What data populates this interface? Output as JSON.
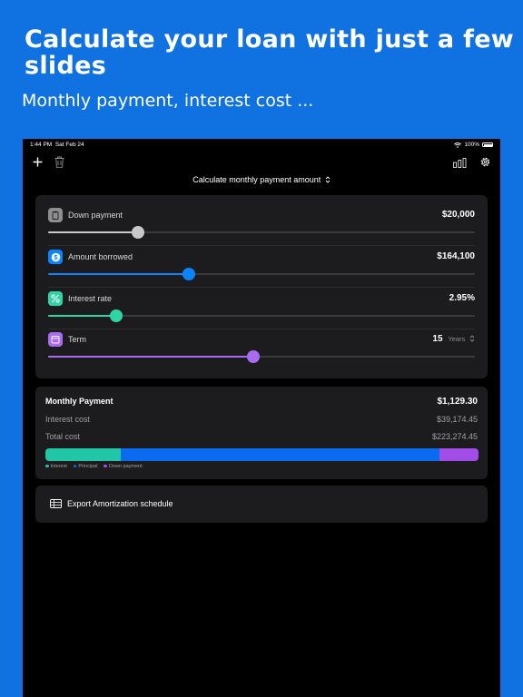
{
  "promo": {
    "headline": "Calculate your loan with just a few slides",
    "subline": "Monthly payment, interest cost ..."
  },
  "status_bar": {
    "time": "1:44 PM",
    "date": "Sat Feb 24",
    "battery": "100%"
  },
  "toolbar": {
    "add_icon": "plus-icon",
    "delete_icon": "trash-icon",
    "chart_icon": "bar-chart-icon",
    "settings_icon": "gear-icon"
  },
  "mode_select": {
    "label": "Calculate monthly payment amount",
    "icon": "chevron-updown-icon"
  },
  "params": {
    "down_payment": {
      "label": "Down payment",
      "value": "$20,000",
      "slider": 0.21,
      "color": "#c7c7cc",
      "icon": "clipboard-icon"
    },
    "amount_borrowed": {
      "label": "Amount borrowed",
      "value": "$164,100",
      "slider": 0.33,
      "color": "#0a84ff",
      "icon": "dollar-icon"
    },
    "interest_rate": {
      "label": "Interest rate",
      "value": "2.95%",
      "slider": 0.16,
      "color": "#30d5a5",
      "icon": "percent-icon"
    },
    "term": {
      "label": "Term",
      "value": "15",
      "unit": "Years",
      "slider": 0.48,
      "color": "#a86cf0",
      "icon": "calendar-icon"
    }
  },
  "summary": {
    "monthly_label": "Monthly Payment",
    "monthly_value": "$1,129.30",
    "interest_label": "Interest cost",
    "interest_value": "$39,174.45",
    "total_label": "Total cost",
    "total_value": "$223,274.45",
    "breakdown": {
      "interest": 0.175,
      "principal": 0.735,
      "down_payment": 0.09
    },
    "legend": {
      "interest": "Interest",
      "principal": "Principal",
      "down_payment": "Down payment"
    }
  },
  "export": {
    "label": "Export Amortization schedule",
    "icon": "table-icon"
  },
  "colors": {
    "interest": "#20c6a6",
    "principal": "#0a6bf0",
    "down_payment": "#a24de8",
    "card": "#1c1c1e",
    "brand_blue": "#1072e0"
  }
}
